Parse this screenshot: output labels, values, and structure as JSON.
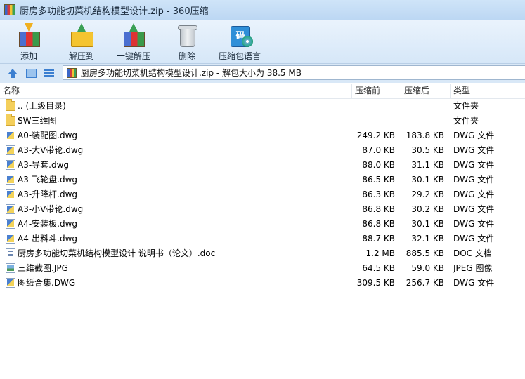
{
  "window": {
    "title": "厨房多功能切菜机结构模型设计.zip - 360压缩"
  },
  "toolbar": {
    "buttons": [
      {
        "label": "添加",
        "icon": "add-archive-icon"
      },
      {
        "label": "解压到",
        "icon": "extract-to-icon"
      },
      {
        "label": "一键解压",
        "icon": "one-click-extract-icon"
      },
      {
        "label": "删除",
        "icon": "trash-icon"
      },
      {
        "label": "压缩包语言",
        "icon": "archive-language-icon"
      }
    ],
    "lang_icon_glyph": "码"
  },
  "address": {
    "text": "厨房多功能切菜机结构模型设计.zip - 解包大小为 38.5 MB"
  },
  "columns": {
    "name": "名称",
    "compressed_before": "压缩前",
    "compressed_after": "压缩后",
    "type": "类型"
  },
  "files": [
    {
      "name": ".. (上级目录)",
      "before": "",
      "after": "",
      "type": "文件夹",
      "icon": "folder"
    },
    {
      "name": "SW三维图",
      "before": "",
      "after": "",
      "type": "文件夹",
      "icon": "folder"
    },
    {
      "name": "A0-装配图.dwg",
      "before": "249.2 KB",
      "after": "183.8 KB",
      "type": "DWG 文件",
      "icon": "dwg"
    },
    {
      "name": "A3-大V带轮.dwg",
      "before": "87.0 KB",
      "after": "30.5 KB",
      "type": "DWG 文件",
      "icon": "dwg"
    },
    {
      "name": "A3-导套.dwg",
      "before": "88.0 KB",
      "after": "31.1 KB",
      "type": "DWG 文件",
      "icon": "dwg"
    },
    {
      "name": "A3-飞轮盘.dwg",
      "before": "86.5 KB",
      "after": "30.1 KB",
      "type": "DWG 文件",
      "icon": "dwg"
    },
    {
      "name": "A3-升降杆.dwg",
      "before": "86.3 KB",
      "after": "29.2 KB",
      "type": "DWG 文件",
      "icon": "dwg"
    },
    {
      "name": "A3-小V带轮.dwg",
      "before": "86.8 KB",
      "after": "30.2 KB",
      "type": "DWG 文件",
      "icon": "dwg"
    },
    {
      "name": "A4-安装板.dwg",
      "before": "86.8 KB",
      "after": "30.1 KB",
      "type": "DWG 文件",
      "icon": "dwg"
    },
    {
      "name": "A4-出料斗.dwg",
      "before": "88.7 KB",
      "after": "32.1 KB",
      "type": "DWG 文件",
      "icon": "dwg"
    },
    {
      "name": "厨房多功能切菜机结构模型设计 说明书（论文）.doc",
      "before": "1.2 MB",
      "after": "885.5 KB",
      "type": "DOC 文档",
      "icon": "doc"
    },
    {
      "name": "三维截图.JPG",
      "before": "64.5 KB",
      "after": "59.0 KB",
      "type": "JPEG 图像",
      "icon": "jpg"
    },
    {
      "name": "图纸合集.DWG",
      "before": "309.5 KB",
      "after": "256.7 KB",
      "type": "DWG 文件",
      "icon": "dwg"
    }
  ]
}
